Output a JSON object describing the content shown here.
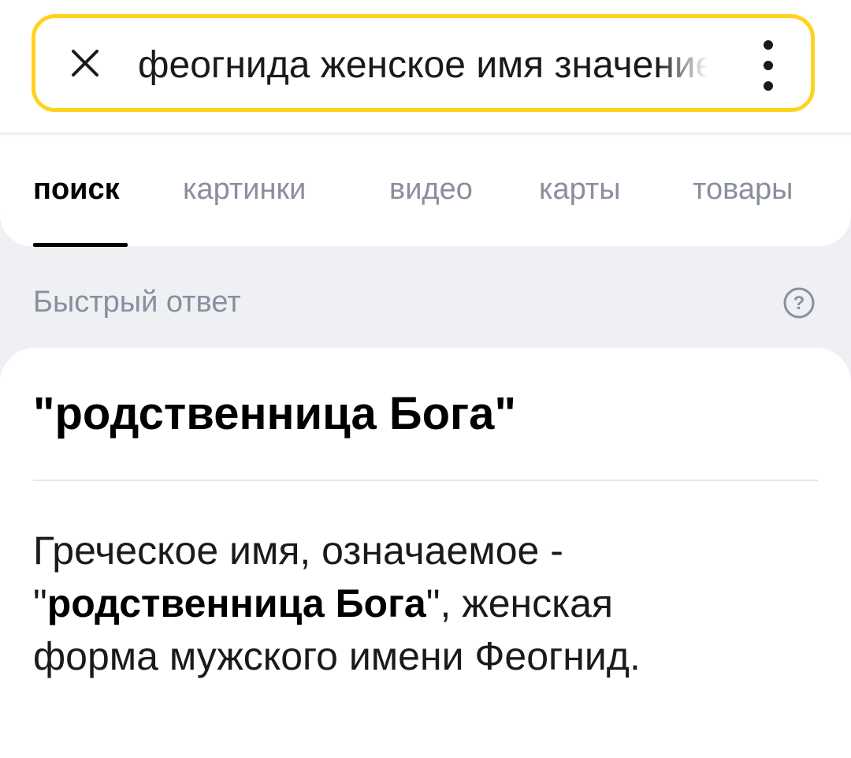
{
  "search": {
    "query": "феогнида женское имя значение"
  },
  "tabs": [
    {
      "label": "поиск",
      "active": true
    },
    {
      "label": "картинки",
      "active": false
    },
    {
      "label": "видео",
      "active": false
    },
    {
      "label": "карты",
      "active": false
    },
    {
      "label": "товары",
      "active": false
    }
  ],
  "quick_answer": {
    "label": "Быстрый ответ",
    "title": "\"родственница Бога\"",
    "body": {
      "line1": "Греческое имя, означаемое -",
      "quote_open": "\"",
      "highlight": "родственница Бога",
      "quote_close": "\"",
      "after_highlight": ", женская",
      "line3": "форма мужского имени Феогнид."
    }
  },
  "icons": {
    "close": "close-icon",
    "more": "more-vertical-icon",
    "help": "help-circle-icon"
  },
  "colors": {
    "search_border": "#ffd21f",
    "muted_text": "#8a8f9e",
    "background": "#eef0f4"
  }
}
